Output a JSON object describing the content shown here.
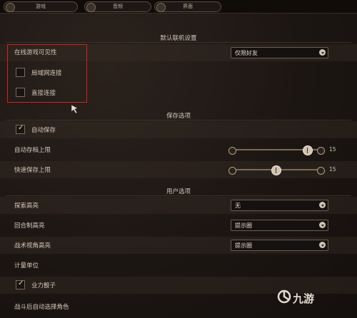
{
  "tabs": [
    {
      "label": "游戏"
    },
    {
      "label": "音频"
    },
    {
      "label": "界面"
    }
  ],
  "sections": {
    "online": "默认联机设置",
    "save": "保存选项",
    "user": "用户选项"
  },
  "online": {
    "visibility_label": "在线游戏可见性",
    "visibility_value": "仅限好友",
    "lan_label": "局域网连接",
    "lan_checked": false,
    "direct_label": "直接连接",
    "direct_checked": false
  },
  "save": {
    "autosave_label": "自动保存",
    "autosave_checked": true,
    "autosave_limit_label": "自动存档上限",
    "autosave_limit_value": "15",
    "quicksave_limit_label": "快速保存上限",
    "quicksave_limit_value": "15",
    "autosave_limit_fraction": 0.85,
    "quicksave_limit_fraction": 0.45
  },
  "user": {
    "explore_highlight_label": "探索高亮",
    "explore_highlight_value": "无",
    "turn_highlight_label": "回合制高亮",
    "turn_highlight_value": "提示圈",
    "tactical_highlight_label": "战术视角高亮",
    "tactical_highlight_value": "提示圈",
    "units_label": "计量单位",
    "karmic_dice_label": "业力骰子",
    "karmic_dice_checked": true,
    "cut_off_label": "战斗后自动选择角色"
  },
  "watermark": {
    "text": "九游"
  },
  "colors": {
    "highlight_box": "#d81f1f",
    "background": "#1f1815"
  }
}
